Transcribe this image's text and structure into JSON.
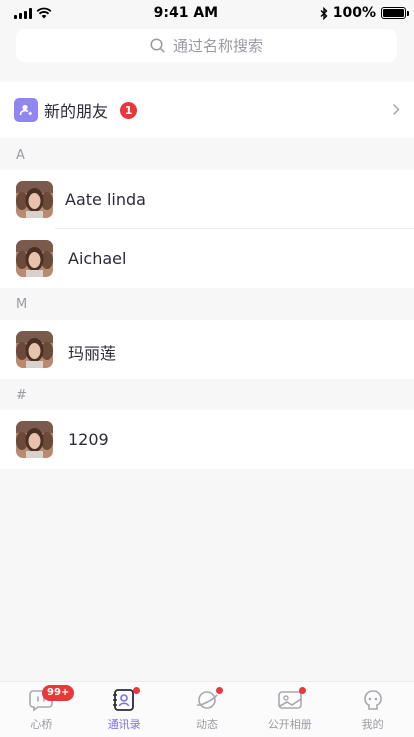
{
  "status_bar": {
    "time": "9:41 AM",
    "battery": "100%"
  },
  "search": {
    "placeholder": "通过名称搜索"
  },
  "new_friends": {
    "label": "新的朋友",
    "badge": "1"
  },
  "sections": [
    {
      "letter": "A",
      "contacts": [
        {
          "name": "Aate linda"
        },
        {
          "name": "Aichael"
        }
      ]
    },
    {
      "letter": "M",
      "contacts": [
        {
          "name": "玛丽莲"
        }
      ]
    },
    {
      "letter": "#",
      "contacts": [
        {
          "name": "1209"
        }
      ]
    }
  ],
  "tabbar": {
    "tabs": [
      {
        "label": "心桥",
        "icon": "chat-bubble-icon",
        "badge": "99+"
      },
      {
        "label": "通讯录",
        "icon": "contacts-book-icon",
        "active": true
      },
      {
        "label": "动态",
        "icon": "planet-icon"
      },
      {
        "label": "公开相册",
        "icon": "photo-album-icon"
      },
      {
        "label": "我的",
        "icon": "profile-face-icon"
      }
    ]
  },
  "colors": {
    "accent": "#7b6fe8",
    "badge": "#e8383c",
    "new_friend_icon": "#8f86f0"
  }
}
